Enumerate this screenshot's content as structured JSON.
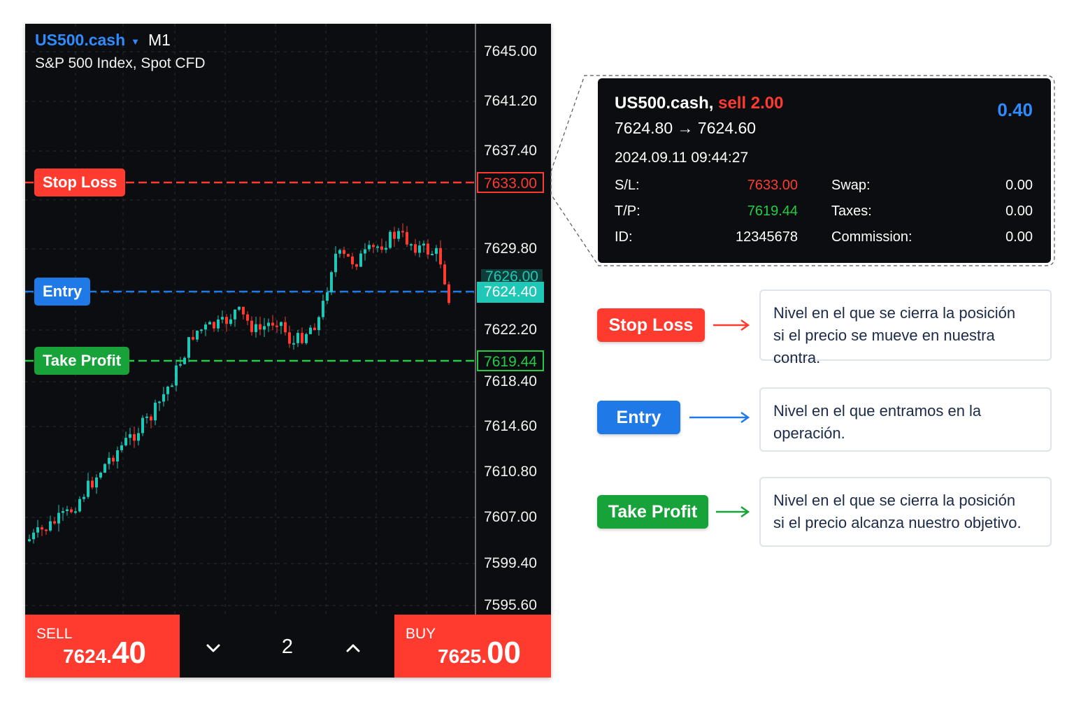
{
  "chart": {
    "symbol": "US500.cash",
    "timeframe": "M1",
    "description": "S&P 500 Index, Spot CFD",
    "axis_labels": [
      "7645.00",
      "7641.20",
      "7637.40",
      "7629.80",
      "7622.20",
      "7618.40",
      "7614.60",
      "7610.80",
      "7607.00",
      "7599.40",
      "7595.60"
    ],
    "levels": {
      "stop_loss": {
        "label": "Stop Loss",
        "price": "7633.00",
        "color": "#ff3b30"
      },
      "entry": {
        "label": "Entry",
        "price": "7624.40",
        "color": "#1f7ae8"
      },
      "take_profit": {
        "label": "Take Profit",
        "price": "7619.44",
        "color": "#22cc44"
      },
      "previous_price": "7626.00"
    }
  },
  "trade_bar": {
    "sell": {
      "label": "SELL",
      "price_main": "7624.",
      "price_big": "40"
    },
    "buy": {
      "label": "BUY",
      "price_main": "7625.",
      "price_big": "00"
    },
    "quantity": "2"
  },
  "popup": {
    "symbol": "US500.cash,",
    "side": "sell 2.00",
    "profit": "0.40",
    "prices": "7624.80 → 7624.60",
    "time": "2024.09.11 09:44:27",
    "rows": [
      {
        "k1": "S/L:",
        "v1": "7633.00",
        "k2": "Swap:",
        "v2": "0.00"
      },
      {
        "k1": "T/P:",
        "v1": "7619.44",
        "k2": "Taxes:",
        "v2": "0.00"
      },
      {
        "k1": "ID:",
        "v1": "12345678",
        "k2": "Commission:",
        "v2": "0.00"
      }
    ]
  },
  "legend": [
    {
      "badge": "Stop Loss",
      "color": "#ff3b30",
      "line1": "Nivel en el que se cierra la posición",
      "line2": "si el precio se mueve en nuestra contra."
    },
    {
      "badge": "Entry",
      "color": "#1f7ae8",
      "line1": "Nivel en el que entramos en la",
      "line2": "operación."
    },
    {
      "badge": "Take Profit",
      "color": "#17a33a",
      "line1": "Nivel en el que se cierra la posición",
      "line2": "si el precio alcanza nuestro objetivo."
    }
  ],
  "candle_colors": {
    "up": "#1fc7b6",
    "down": "#ff3b30"
  }
}
